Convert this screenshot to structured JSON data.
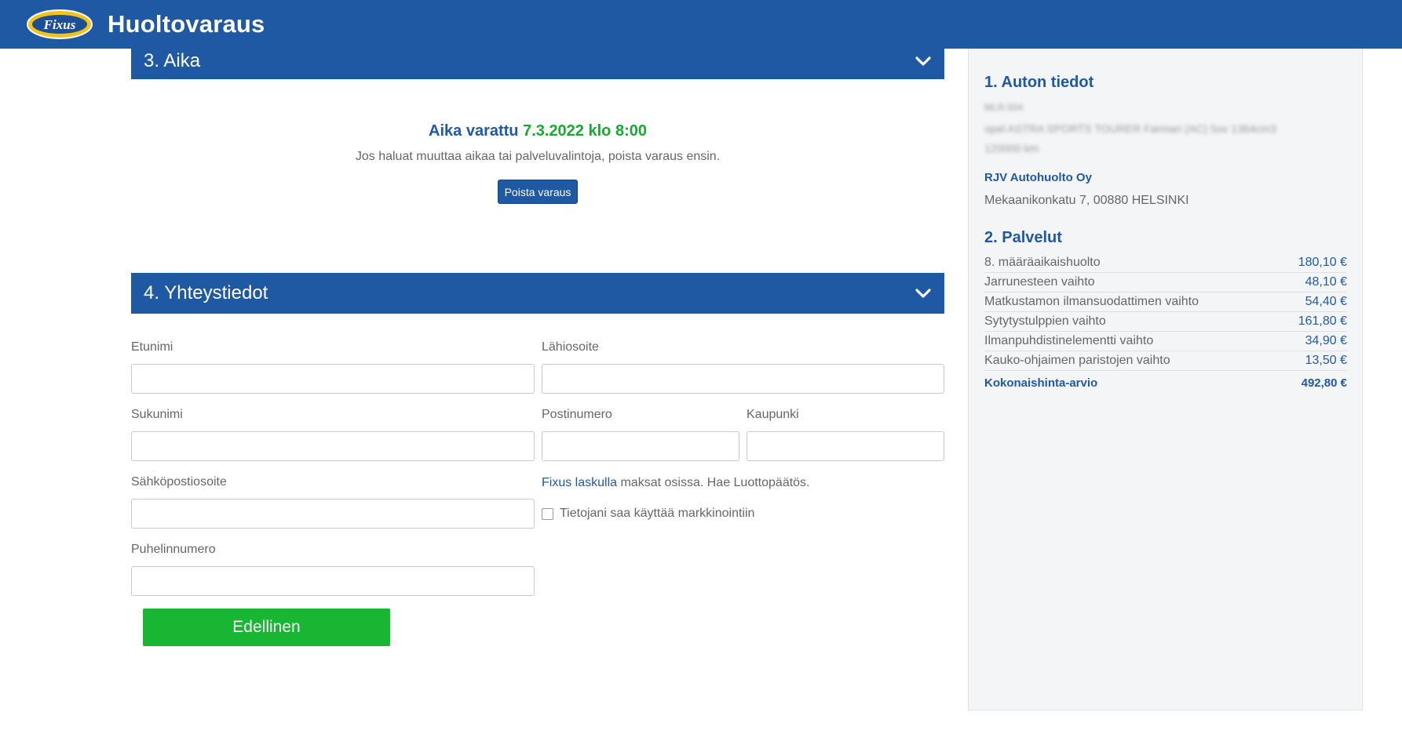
{
  "header": {
    "logo_text": "Fixus",
    "title": "Huoltovaraus"
  },
  "section3": {
    "title": "3. Aika",
    "booked_label": "Aika varattu",
    "booked_datetime": "7.3.2022 klo 8:00",
    "note": "Jos haluat muuttaa aikaa tai palveluvalintoja, poista varaus ensin.",
    "delete_button": "Poista varaus"
  },
  "section4": {
    "title": "4. Yhteystiedot",
    "fields": {
      "first_name": {
        "label": "Etunimi",
        "value": ""
      },
      "last_name": {
        "label": "Sukunimi",
        "value": ""
      },
      "email": {
        "label": "Sähköpostiosoite",
        "value": ""
      },
      "phone": {
        "label": "Puhelinnumero",
        "value": ""
      },
      "street": {
        "label": "Lähiosoite",
        "value": ""
      },
      "postal_code": {
        "label": "Postinumero",
        "value": ""
      },
      "city": {
        "label": "Kaupunki",
        "value": ""
      }
    },
    "credit_link": "Fixus laskulla",
    "credit_text": " maksat osissa. Hae Luottopäätös.",
    "consent_label": "Tietojani saa käyttää markkinointiin",
    "consent_checked": false,
    "prev_button": "Edellinen"
  },
  "sidebar": {
    "car_heading": "1. Auton tiedot",
    "car_plate": "MLR-504",
    "car_model": "opel ASTRA SPORTS TOURER Farmari (AC) 5ov 1364cm3",
    "car_mileage": "120000 km",
    "garage_name": "RJV Autohuolto Oy",
    "garage_address": "Mekaanikonkatu 7, 00880 HELSINKI",
    "services_heading": "2. Palvelut",
    "services": [
      {
        "name": "8. määräaikaishuolto",
        "price": "180,10 €"
      },
      {
        "name": "Jarrunesteen vaihto",
        "price": "48,10 €"
      },
      {
        "name": "Matkustamon ilmansuodattimen vaihto",
        "price": "54,40 €"
      },
      {
        "name": "Sytytystulppien vaihto",
        "price": "161,80 €"
      },
      {
        "name": "Ilmanpuhdistinelementti vaihto",
        "price": "34,90 €"
      },
      {
        "name": "Kauko-ohjaimen paristojen vaihto",
        "price": "13,50 €"
      }
    ],
    "total_label": "Kokonaishinta-arvio",
    "total_value": "492,80 €"
  },
  "colors": {
    "brand_blue": "#2059a3",
    "accent_green": "#19b634",
    "time_green": "#19a832"
  }
}
